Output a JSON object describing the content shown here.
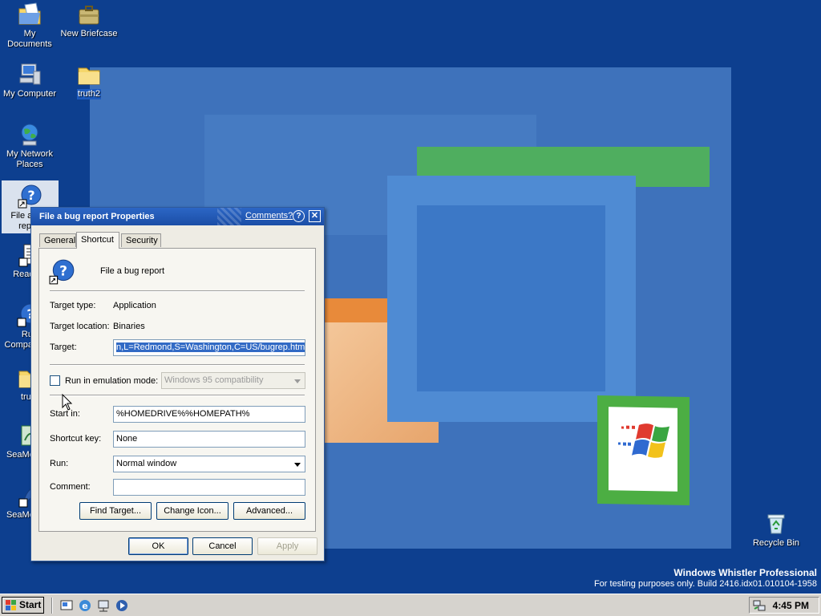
{
  "desktop": {
    "icons": [
      {
        "label": "My Documents"
      },
      {
        "label": "New Briefcase"
      },
      {
        "label": "My Computer"
      },
      {
        "label": "truth2"
      },
      {
        "label": "My Network Places"
      },
      {
        "label": "File a bug report"
      },
      {
        "label": "Readme"
      },
      {
        "label": "Run Compatibility"
      },
      {
        "label": "truth"
      },
      {
        "label": "SeaMonkey"
      },
      {
        "label": "SeaMonkey"
      },
      {
        "label": "Recycle Bin"
      }
    ]
  },
  "dialog": {
    "title": "File a bug report Properties",
    "comments_link": "Comments?",
    "help_label": "?",
    "close_label": "✕",
    "tabs": [
      {
        "label": "General"
      },
      {
        "label": "Shortcut"
      },
      {
        "label": "Security"
      }
    ],
    "shortcut_name": "File a bug report",
    "target_type_label": "Target type:",
    "target_type_value": "Application",
    "target_location_label": "Target location:",
    "target_location_value": "Binaries",
    "target_label": "Target:",
    "target_value": "n,L=Redmond,S=Washington,C=US/bugrep.htm",
    "emulation_label": "Run in emulation mode:",
    "emulation_value": "Windows 95 compatibility",
    "start_in_label": "Start in:",
    "start_in_value": "%HOMEDRIVE%%HOMEPATH%",
    "shortcut_key_label": "Shortcut key:",
    "shortcut_key_value": "None",
    "run_label": "Run:",
    "run_value": "Normal window",
    "comment_label": "Comment:",
    "comment_value": "",
    "find_target_label": "Find Target...",
    "change_icon_label": "Change Icon...",
    "advanced_label": "Advanced...",
    "ok_label": "OK",
    "cancel_label": "Cancel",
    "apply_label": "Apply"
  },
  "branding": {
    "line1": "Windows Whistler Professional",
    "line2": "For testing purposes only. Build 2416.idx01.010104-1958"
  },
  "taskbar": {
    "start_label": "Start",
    "clock": "4:45 PM"
  },
  "colors": {
    "desktop_bg": "#0d3f8f",
    "titlebar": "#2c66c5",
    "selection": "#316ac5"
  }
}
